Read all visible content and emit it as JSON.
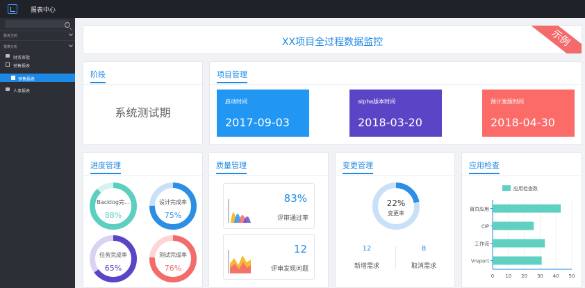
{
  "app": {
    "title": "报表中心"
  },
  "sidebar": {
    "sections": [
      {
        "label": "我关注的"
      },
      {
        "label": "报表分析"
      }
    ],
    "items": [
      {
        "label": "财务审批"
      },
      {
        "label": "销售报表"
      },
      {
        "label": "销售报表"
      },
      {
        "label": "人事报表"
      }
    ]
  },
  "banner": {
    "title": "XX项目全过程数据监控",
    "ribbon": "示例"
  },
  "stage": {
    "title": "阶段",
    "value": "系统测试期"
  },
  "project": {
    "title": "项目管理",
    "tiles": [
      {
        "label": "启动时间",
        "value": "2017-09-03",
        "color": "#2196f3"
      },
      {
        "label": "alpha版本时间",
        "value": "2018-03-20",
        "color": "#5b45c6"
      },
      {
        "label": "预计发版时间",
        "value": "2018-04-30",
        "color": "#fb6b68"
      }
    ]
  },
  "progress": {
    "title": "进度管理",
    "donuts": [
      {
        "label": "Backlog完...",
        "percent": 88,
        "value_text": "88%",
        "color": "#5ccfc0",
        "track": "#d6f3ef"
      },
      {
        "label": "设计完成率",
        "percent": 75,
        "value_text": "75%",
        "color": "#2d8fe3",
        "track": "#c9e1f8"
      },
      {
        "label": "任务完成率",
        "percent": 65,
        "value_text": "65%",
        "color": "#5b45c6",
        "track": "#d9d2f3"
      },
      {
        "label": "测试完成率",
        "percent": 76,
        "value_text": "76%",
        "color": "#f46b6b",
        "track": "#fcd6d6"
      }
    ]
  },
  "quality": {
    "title": "质量管理",
    "boxes": [
      {
        "value": "83%",
        "label": "评审通过率"
      },
      {
        "value": "12",
        "label": "评审发现问题"
      }
    ]
  },
  "change": {
    "title": "变更管理",
    "rate_percent": 22,
    "rate_text": "22%",
    "rate_label": "变更率",
    "stats": [
      {
        "value": "12",
        "label": "新增需求"
      },
      {
        "value": "8",
        "label": "取消需求"
      }
    ]
  },
  "app_check": {
    "title": "应用检查",
    "chart_data": {
      "type": "bar",
      "orientation": "horizontal",
      "title": "",
      "legend": [
        "应用检查数"
      ],
      "categories": [
        "首页应用",
        "CIP",
        "工作流",
        "Vreport"
      ],
      "series": [
        {
          "name": "应用检查数",
          "values": [
            43,
            26,
            33,
            31
          ],
          "color": "#5fd0c2"
        }
      ],
      "xlim": [
        0,
        50
      ],
      "xticks": [
        0,
        10,
        20,
        30,
        40,
        50
      ]
    }
  }
}
